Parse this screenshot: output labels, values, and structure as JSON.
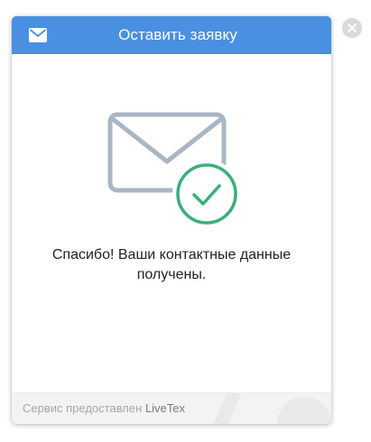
{
  "widget": {
    "header": {
      "title": "Оставить заявку",
      "icon": "envelope-icon",
      "color": "#4a90e2"
    },
    "close_icon": "close-icon",
    "illustration": {
      "icon": "envelope-check-icon",
      "envelope_color": "#a9b6c4",
      "check_color": "#3ab07a"
    },
    "message": {
      "line1": "Спасибо! Ваши контактные данные",
      "line2": "получены."
    },
    "footer": {
      "text": "Сервис предоставлен",
      "brand": "LiveTex"
    }
  }
}
